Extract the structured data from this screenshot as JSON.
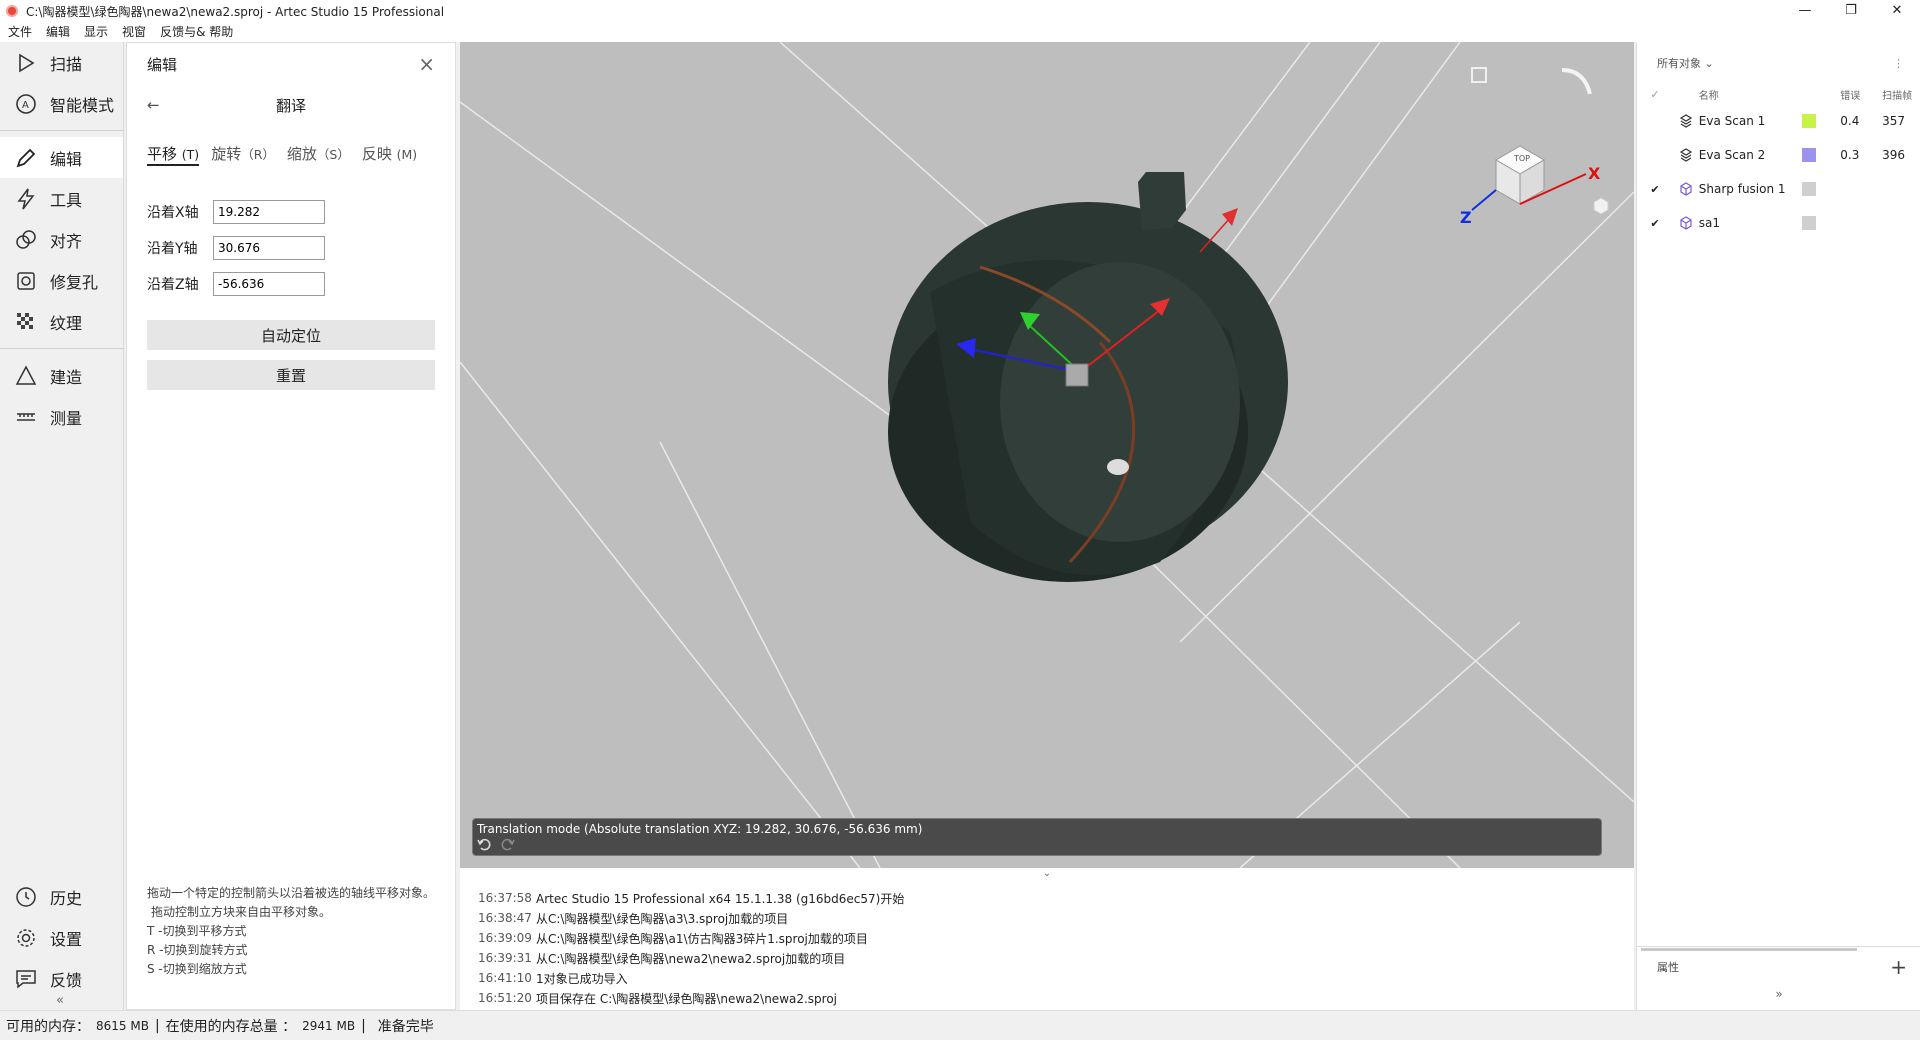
{
  "window": {
    "title": "C:\\陶器模型\\绿色陶器\\newa2\\newa2.sproj - Artec Studio 15 Professional",
    "minimize_glyph": "—",
    "maximize_glyph": "❐",
    "close_glyph": "✕"
  },
  "menu": [
    "文件",
    "编辑",
    "显示",
    "视窗",
    "反馈与& 帮助"
  ],
  "nav": {
    "top": [
      {
        "label": "扫描",
        "icon": "play-icon"
      },
      {
        "label": "智能模式",
        "icon": "autopilot-icon"
      }
    ],
    "middle": [
      {
        "label": "编辑",
        "icon": "pencil-icon"
      },
      {
        "label": "工具",
        "icon": "lightning-icon"
      },
      {
        "label": "对齐",
        "icon": "align-icon"
      },
      {
        "label": "修复孔",
        "icon": "hole-fill-icon"
      },
      {
        "label": "纹理",
        "icon": "texture-icon"
      }
    ],
    "bottom_tools": [
      {
        "label": "建造",
        "icon": "triangle-icon"
      },
      {
        "label": "测量",
        "icon": "ruler-icon"
      }
    ],
    "footer": [
      {
        "label": "历史",
        "icon": "history-icon"
      },
      {
        "label": "设置",
        "icon": "gear-icon"
      },
      {
        "label": "反馈",
        "icon": "feedback-icon"
      }
    ],
    "collapse": "«"
  },
  "edit_panel": {
    "header": "编辑",
    "close": "×",
    "back": "←",
    "subtitle": "翻译",
    "tabs": [
      {
        "label": "平移",
        "key": "(T)"
      },
      {
        "label": "旋转",
        "key": "（R）"
      },
      {
        "label": "缩放",
        "key": "（S）"
      },
      {
        "label": "反映",
        "key": "(M)"
      }
    ],
    "fields": [
      {
        "label": "沿着X轴",
        "value": "19.282"
      },
      {
        "label": "沿着Y轴",
        "value": "30.676"
      },
      {
        "label": "沿着Z轴",
        "value": "-56.636"
      }
    ],
    "auto_position": "自动定位",
    "reset": "重置",
    "help": [
      "拖动一个特定的控制箭头以沿着被选的轴线平移对象。",
      "拖动控制立方块来自由平移对象。",
      "T -切换到平移方式",
      "R -切换到旋转方式",
      "S -切换到缩放方式"
    ]
  },
  "viewport": {
    "status_text": "Translation mode (Absolute translation XYZ: 19.282, 30.676, -56.636 mm)",
    "cube_top_label": "TOP",
    "axis_x": "X",
    "axis_z": "Z"
  },
  "log_toggle": "⌄",
  "log": [
    {
      "time": "16:37:58",
      "msg": "Artec Studio 15 Professional x64 15.1.1.38 (g16bd6ec57)开始"
    },
    {
      "time": "16:38:47",
      "msg": "从C:\\陶器模型\\绿色陶器\\a3\\3.sproj加载的项目"
    },
    {
      "time": "16:39:09",
      "msg": "从C:\\陶器模型\\绿色陶器\\a1\\仿古陶器3碎片1.sproj加载的项目"
    },
    {
      "time": "16:39:31",
      "msg": "从C:\\陶器模型\\绿色陶器\\newa2\\newa2.sproj加载的项目"
    },
    {
      "time": "16:41:10",
      "msg": "1对象已成功导入"
    },
    {
      "time": "16:51:20",
      "msg": "项目保存在 C:\\陶器模型\\绿色陶器\\newa2\\newa2.sproj"
    }
  ],
  "objects": {
    "filter": "所有对象",
    "filter_chevron": "⌄",
    "more": "⋮",
    "head_check": "✓",
    "col_name": "名称",
    "col_error": "错误",
    "col_frames": "扫描帧",
    "rows": [
      {
        "check": "",
        "icon": "scan-layers-icon",
        "name": "Eva Scan 1",
        "color": "#c6f24a",
        "error": "0.4",
        "frames": "357"
      },
      {
        "check": "",
        "icon": "scan-layers-icon",
        "name": "Eva Scan 2",
        "color": "#9a94f0",
        "error": "0.3",
        "frames": "396"
      },
      {
        "check": "✔",
        "icon": "model-cube-icon",
        "name": "Sharp fusion 1",
        "color": "#cfcfcf",
        "error": "",
        "frames": ""
      },
      {
        "check": "✔",
        "icon": "model-cube-icon",
        "name": "sa1",
        "color": "#cfcfcf",
        "error": "",
        "frames": ""
      }
    ],
    "properties": "属性",
    "add": "+",
    "expand": "»"
  },
  "statusbar": {
    "mem_free_label": "可用的内存：",
    "mem_free": "8615 MB",
    "sep": "|",
    "mem_used_label": "在使用的内存总量 ：",
    "mem_used": "2941 MB",
    "ready": "准备完毕"
  }
}
